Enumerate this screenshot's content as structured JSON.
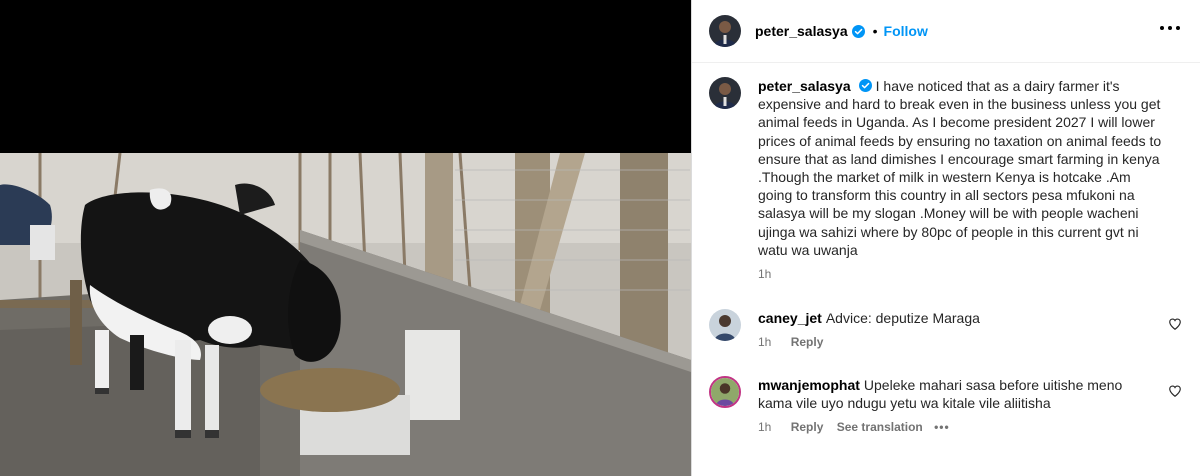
{
  "post": {
    "author": "peter_salasya",
    "follow_label": "Follow",
    "dot": "•",
    "more_label": "···"
  },
  "caption": {
    "username": "peter_salasya",
    "text": "I have noticed that as a dairy farmer it's expensive and hard to break even in the business unless you get animal feeds in Uganda. As I become president 2027 I will lower prices of animal feeds by ensuring no taxation on animal feeds to ensure that as land dimishes I encourage smart farming in kenya .Though the market of milk in western Kenya is hotcake .Am going to transform this country in all sectors pesa mfukoni na salasya will be my slogan .Money will be with people wacheni ujinga wa sahizi where by 80pc of people in this current gvt ni watu wa uwanja",
    "time": "1h"
  },
  "comments": [
    {
      "username": "caney_jet",
      "text": "Advice: deputize Maraga",
      "time": "1h",
      "reply_label": "Reply"
    },
    {
      "username": "mwanjemophat",
      "text": "Upeleke mahari sasa before uitishe meno kama vile uyo ndugu yetu wa kitale vile aliitisha",
      "time": "1h",
      "reply_label": "Reply",
      "translate_label": "See translation",
      "more_label": "•••"
    }
  ],
  "colors": {
    "accent": "#0095f6",
    "verified": "#0095f6",
    "muted": "#737373"
  },
  "icons": [
    "verified-badge-icon",
    "more-options-icon",
    "heart-icon"
  ]
}
